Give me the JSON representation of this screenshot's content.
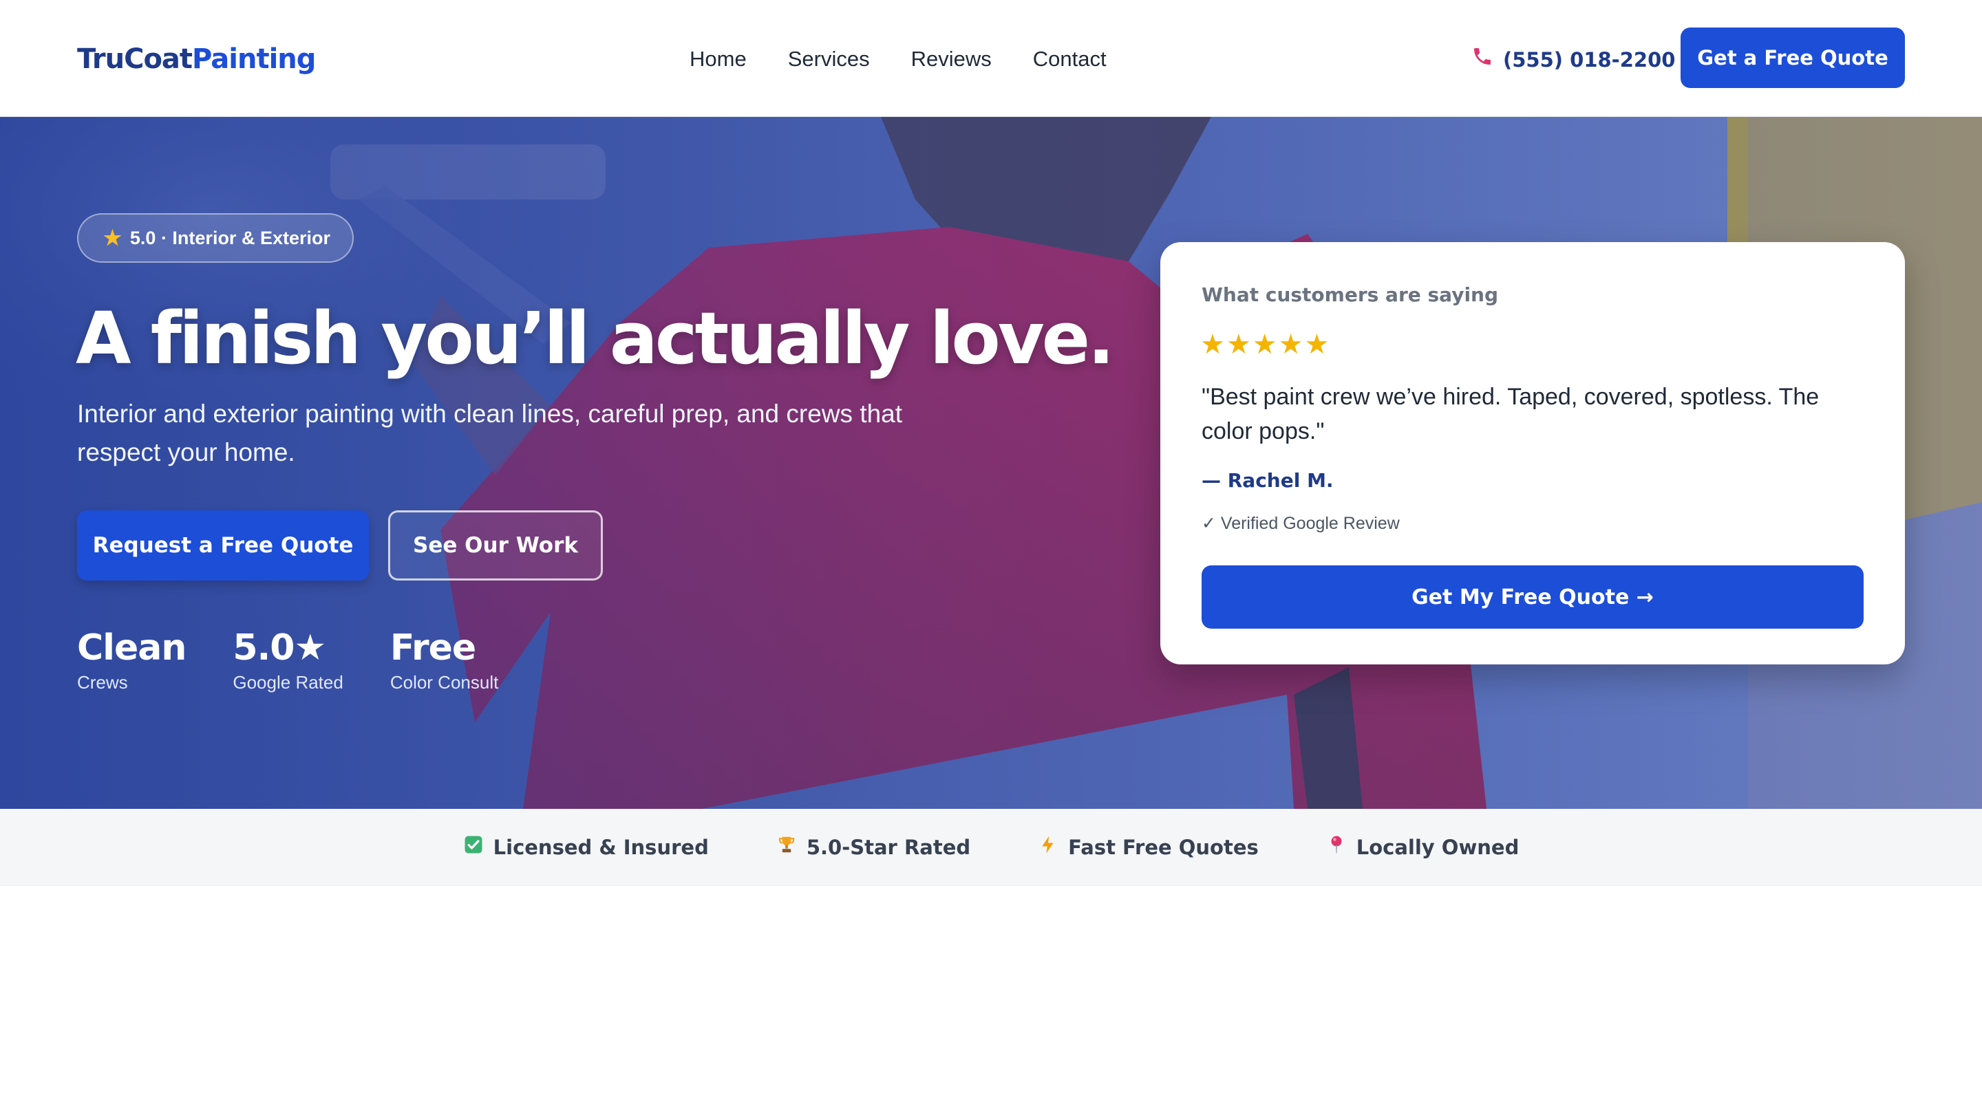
{
  "header": {
    "logo_part1": "TruCoat",
    "logo_part2": "Painting",
    "nav": [
      "Home",
      "Services",
      "Reviews",
      "Contact"
    ],
    "phone": "(555) 018-2200",
    "cta": "Get a Free Quote"
  },
  "hero": {
    "badge": "5.0 · Interior & Exterior",
    "title": "A finish you’ll actually love.",
    "subtitle": "Interior and exterior painting with clean lines, careful prep, and crews that respect your home.",
    "primary_cta": "Request a Free Quote",
    "secondary_cta": "See Our Work",
    "stats": [
      {
        "value": "Clean",
        "label": "Crews"
      },
      {
        "value": "5.0★",
        "label": "Google Rated"
      },
      {
        "value": "Free",
        "label": "Color Consult"
      }
    ]
  },
  "review_card": {
    "heading": "What customers are saying",
    "stars": "★★★★★",
    "quote": "\"Best paint crew we’ve hired. Taped, covered, spotless. The color pops.\"",
    "author": "— Rachel M.",
    "verified": "✓ Verified Google Review",
    "cta": "Get My Free Quote →"
  },
  "trust_bar": [
    {
      "icon": "check-box-icon",
      "label": "Licensed & Insured"
    },
    {
      "icon": "trophy-icon",
      "label": "5.0-Star Rated"
    },
    {
      "icon": "lightning-icon",
      "label": "Fast Free Quotes"
    },
    {
      "icon": "pin-icon",
      "label": "Locally Owned"
    }
  ],
  "colors": {
    "brand_dark": "#1e3a8a",
    "brand": "#1d4ed8",
    "star": "#f5b400"
  }
}
